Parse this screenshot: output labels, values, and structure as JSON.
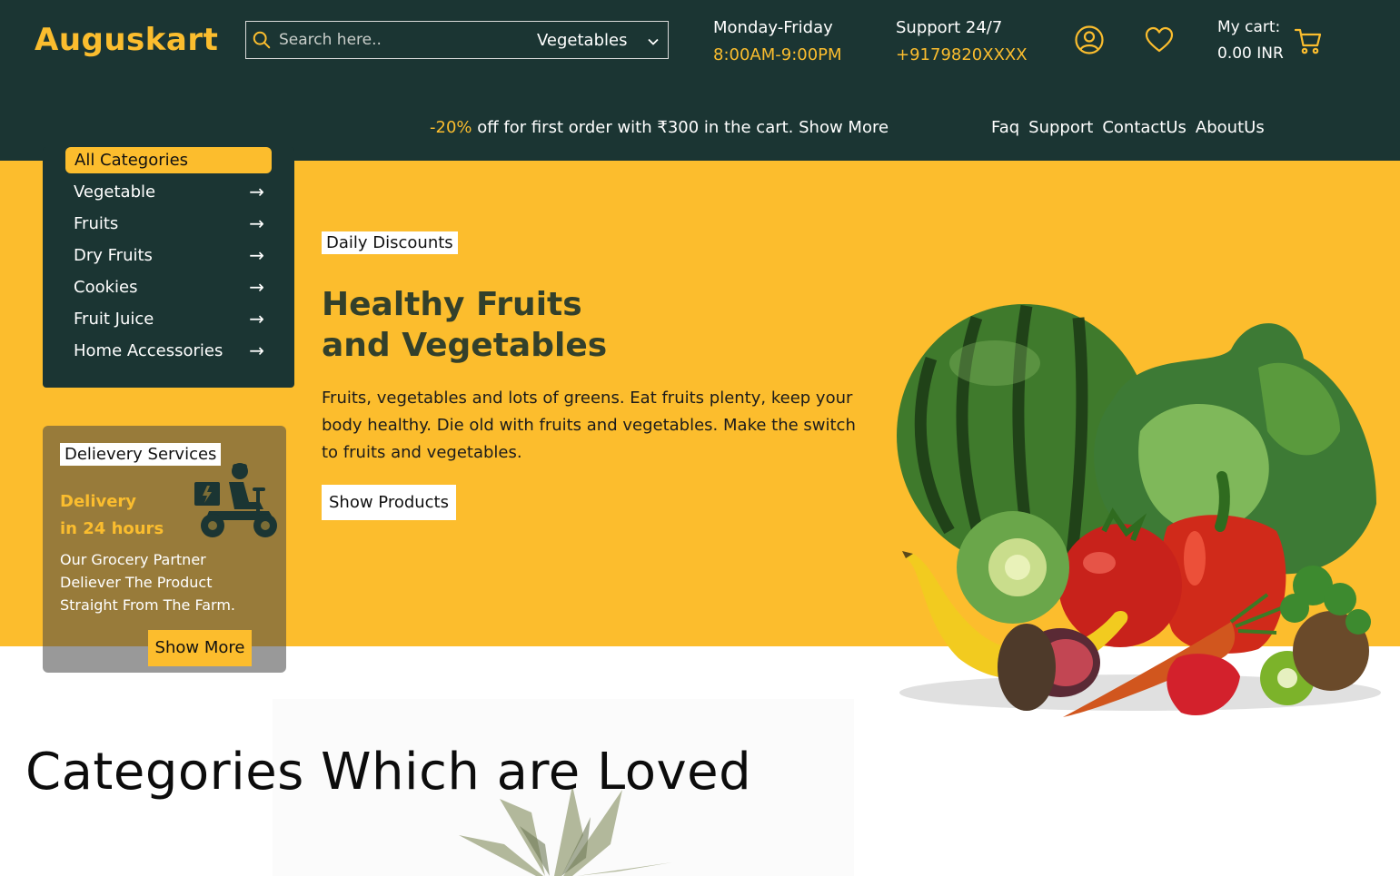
{
  "header": {
    "logo": "Auguskart",
    "search": {
      "placeholder": "Search here..",
      "category": "Vegetables"
    },
    "hours": {
      "label": "Monday-Friday",
      "value": "8:00AM-9:00PM"
    },
    "support": {
      "label": "Support 24/7",
      "value": "+9179820XXXX"
    },
    "cart": {
      "label": "My cart:",
      "amount": "0.00 INR"
    },
    "icons": {
      "search": "search-icon",
      "user": "user-icon",
      "wishlist": "heart-icon",
      "cart": "cart-icon",
      "dropdown": "chevron-down-icon"
    },
    "promo": {
      "highlight": "-20%",
      "text": " off for first order with ₹300 in the cart. Show More"
    },
    "nav": [
      "Faq",
      "Support",
      "ContactUs",
      "AboutUs"
    ]
  },
  "sidebar": {
    "title": "All Categories",
    "items": [
      {
        "label": "Vegetable",
        "arrow": "→"
      },
      {
        "label": "Fruits",
        "arrow": "→"
      },
      {
        "label": "Dry Fruits",
        "arrow": "→"
      },
      {
        "label": "Cookies",
        "arrow": "→"
      },
      {
        "label": "Fruit Juice",
        "arrow": "→"
      },
      {
        "label": "Home Accessories",
        "arrow": "→"
      }
    ]
  },
  "delivery": {
    "tag": "Delievery Services",
    "title_line1": "Delivery",
    "title_line2": "in 24 hours",
    "description": "Our Grocery Partner Deliever The Product Straight From The Farm.",
    "button": "Show More"
  },
  "hero": {
    "badge": "Daily Discounts",
    "title_line1": "Healthy Fruits",
    "title_line2": "and Vegetables",
    "description": "Fruits, vegetables and lots of greens. Eat fruits plenty, keep your body healthy. Die old with fruits and vegetables. Make the switch to fruits and vegetables.",
    "button": "Show Products"
  },
  "section": {
    "title": "Categories Which are Loved"
  },
  "colors": {
    "dark": "#1b3533",
    "accent": "#fcbd2d",
    "text_dark_green": "#33402b"
  }
}
